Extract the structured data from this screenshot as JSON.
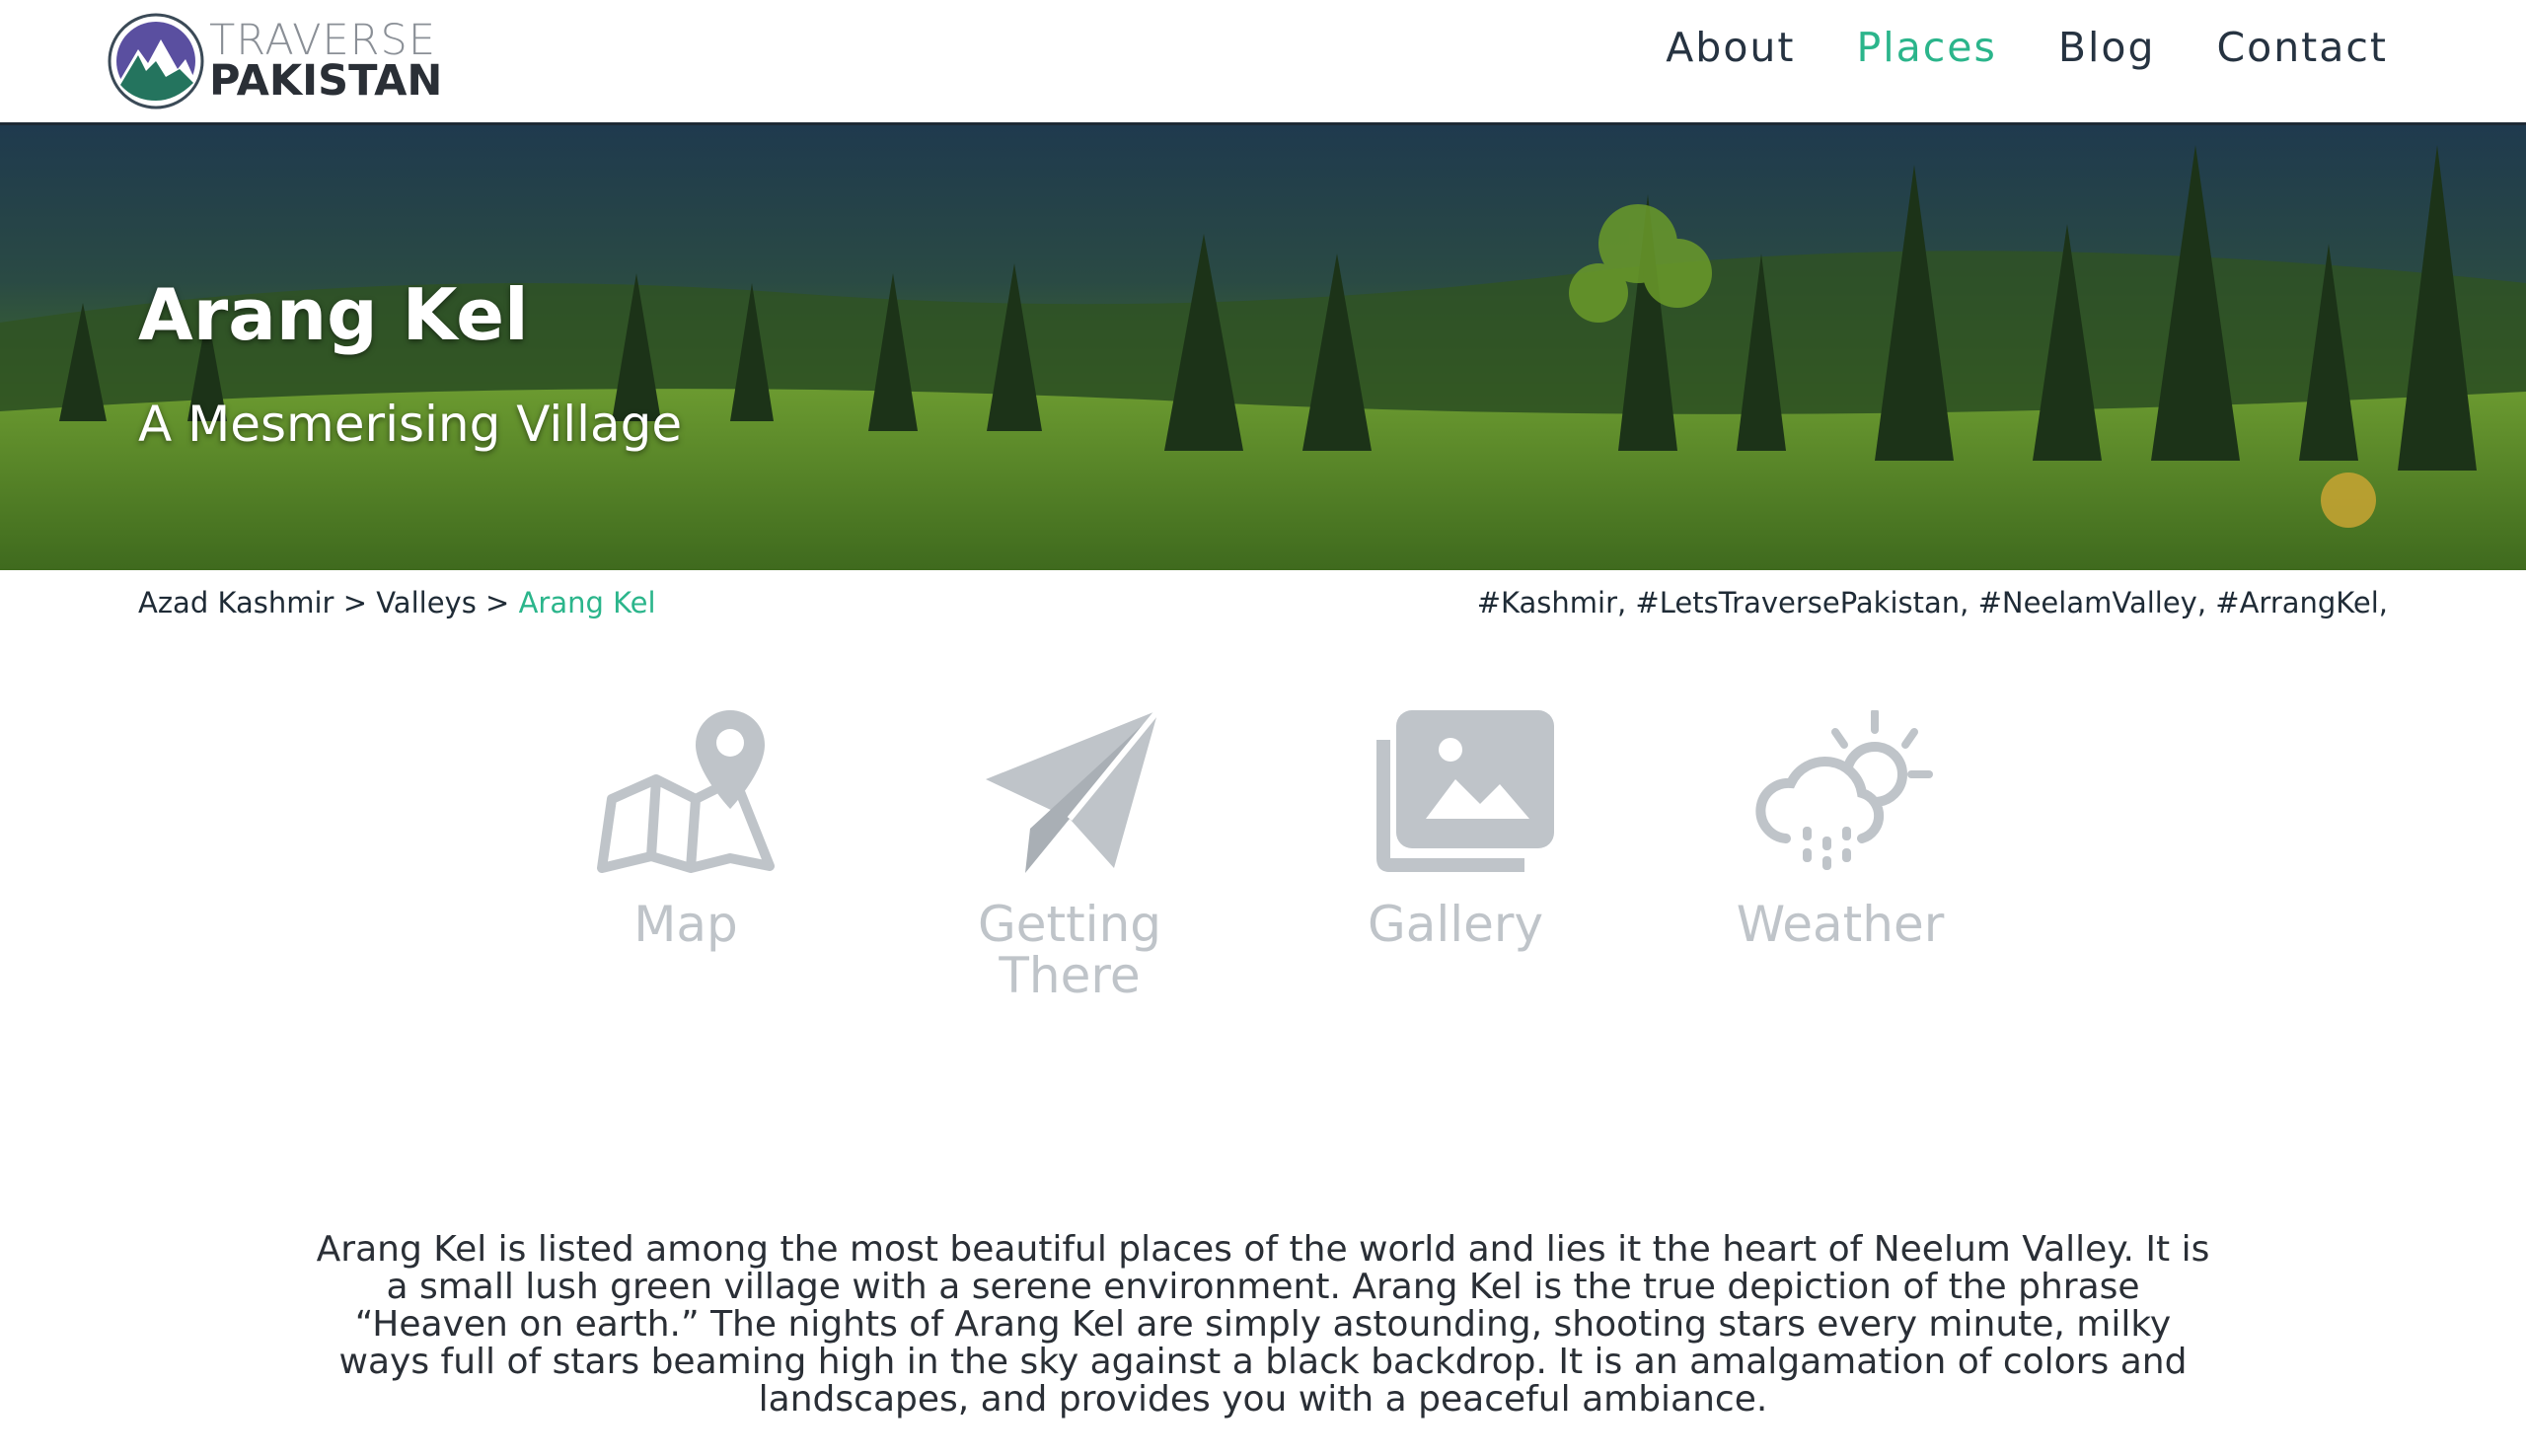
{
  "brand": {
    "line1": "TRAVERSE",
    "line2": "PAKISTAN",
    "accent": "#2bb58b",
    "dark": "#263341"
  },
  "nav": {
    "items": [
      {
        "label": "About",
        "active": false
      },
      {
        "label": "Places",
        "active": true
      },
      {
        "label": "Blog",
        "active": false
      },
      {
        "label": "Contact",
        "active": false
      }
    ]
  },
  "hero": {
    "title": "Arang Kel",
    "subtitle": "A Mesmerising Village"
  },
  "breadcrumb": {
    "items": [
      "Azad Kashmir",
      "Valleys",
      "Arang Kel"
    ],
    "separator": ">"
  },
  "tags": "#Kashmir, #LetsTraversePakistan, #NeelamValley, #ArrangKel,",
  "features": [
    {
      "icon": "map-pin-icon",
      "label_line1": "Map",
      "label_line2": ""
    },
    {
      "icon": "paper-plane-icon",
      "label_line1": "Getting",
      "label_line2": "There"
    },
    {
      "icon": "gallery-icon",
      "label_line1": "Gallery",
      "label_line2": ""
    },
    {
      "icon": "weather-icon",
      "label_line1": "Weather",
      "label_line2": ""
    }
  ],
  "description": "Arang Kel is listed among the most beautiful places of the world and lies it the heart of Neelum Valley. It is a small lush green village with a serene environment. Arang Kel is the true depiction of the phrase “Heaven on earth.” The nights of Arang Kel are simply astounding, shooting stars every minute, milky ways full of stars beaming high in the sky against a black backdrop. It is an amalgamation of colors and landscapes, and provides you with a peaceful ambiance."
}
